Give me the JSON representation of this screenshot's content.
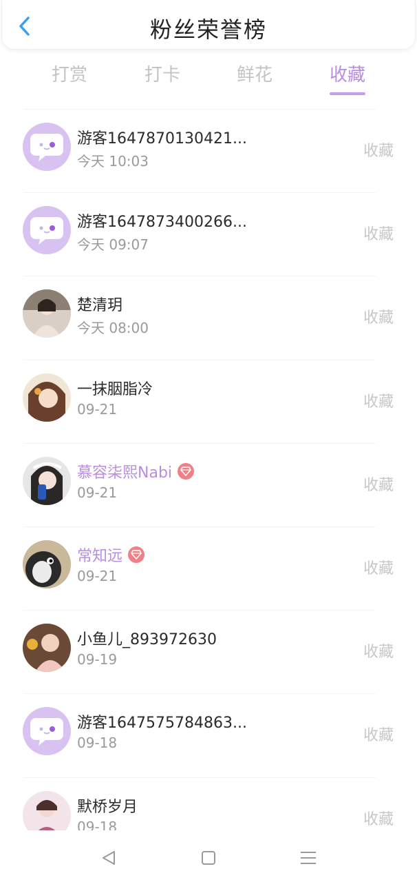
{
  "header": {
    "title": "粉丝荣誉榜",
    "back_icon": "chevron-left-icon"
  },
  "tabs": [
    {
      "label": "打赏",
      "active": false
    },
    {
      "label": "打卡",
      "active": false
    },
    {
      "label": "鲜花",
      "active": false
    },
    {
      "label": "收藏",
      "active": true
    }
  ],
  "accent_color": "#b98de0",
  "list": {
    "items": [
      {
        "name": "游客1647870130421...",
        "date": "今天 10:03",
        "action": "收藏",
        "avatar": "default-chat-avatar",
        "vip": false
      },
      {
        "name": "游客1647873400266...",
        "date": "今天 09:07",
        "action": "收藏",
        "avatar": "default-chat-avatar",
        "vip": false
      },
      {
        "name": "楚清玥",
        "date": "今天 08:00",
        "action": "收藏",
        "avatar": "user-photo-avatar",
        "vip": false
      },
      {
        "name": "一抹胭脂冷",
        "date": "09-21",
        "action": "收藏",
        "avatar": "user-photo-avatar",
        "vip": false
      },
      {
        "name": "慕容柒熙Nabi",
        "date": "09-21",
        "action": "收藏",
        "avatar": "user-photo-avatar",
        "vip": true
      },
      {
        "name": "常知远",
        "date": "09-21",
        "action": "收藏",
        "avatar": "user-photo-avatar",
        "vip": true
      },
      {
        "name": "小鱼儿_893972630",
        "date": "09-19",
        "action": "收藏",
        "avatar": "user-photo-avatar",
        "vip": false
      },
      {
        "name": "游客1647575784863...",
        "date": "09-18",
        "action": "收藏",
        "avatar": "default-chat-avatar",
        "vip": false
      },
      {
        "name": "默桥岁月",
        "date": "09-18",
        "action": "收藏",
        "avatar": "user-photo-avatar",
        "vip": false
      }
    ]
  },
  "navbar": {
    "back_icon": "triangle-back-icon",
    "home_icon": "square-home-icon",
    "menu_icon": "menu-lines-icon"
  }
}
